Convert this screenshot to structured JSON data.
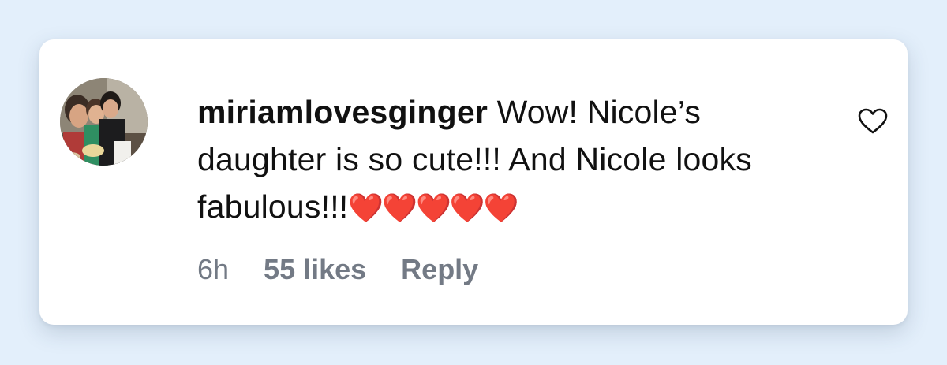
{
  "comment": {
    "username": "miriamlovesginger",
    "text": "Wow! Nicole’s daughter is so cute!!! And Nicole looks fabulous!!!",
    "emoji": "❤️❤️❤️❤️❤️",
    "timestamp": "6h",
    "likes_label": "55 likes",
    "reply_label": "Reply",
    "heart_icon": "heart-outline-icon"
  },
  "colors": {
    "page_background": "#e3effb",
    "card_background": "#ffffff",
    "text": "#111111",
    "meta_text": "#737a85",
    "heart_emoji": "#e8212c"
  }
}
